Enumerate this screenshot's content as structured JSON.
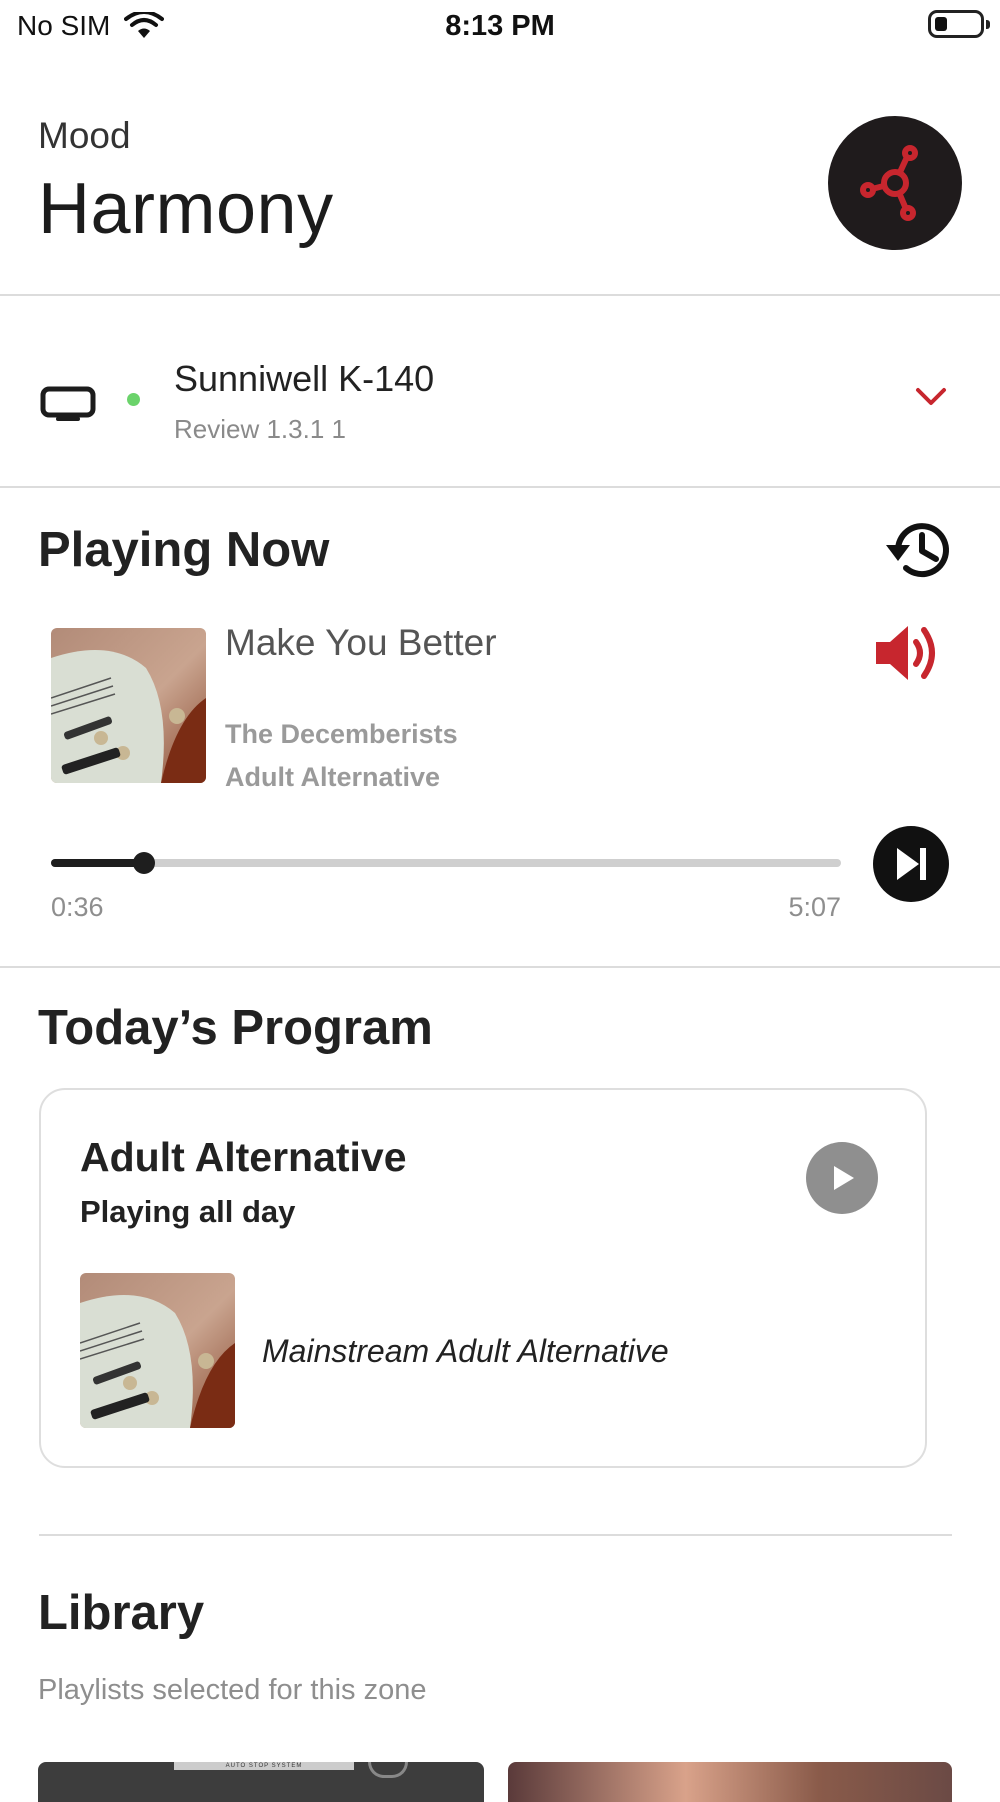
{
  "status_bar": {
    "carrier": "No SIM",
    "time": "8:13 PM"
  },
  "header": {
    "label": "Mood",
    "title": "Harmony",
    "mood_button_icon": "share-nodes-icon"
  },
  "device": {
    "name": "Sunniwell K-140",
    "subtitle": "Review 1.3.1 1",
    "status_color": "#6bd36b"
  },
  "playing_now": {
    "heading": "Playing Now",
    "track": {
      "title": "Make You Better",
      "artist": "The Decemberists",
      "genre": "Adult Alternative"
    },
    "elapsed": "0:36",
    "duration": "5:07",
    "progress_fraction": 0.118
  },
  "program": {
    "heading": "Today’s Program",
    "card_title": "Adult Alternative",
    "card_subtitle": "Playing all day",
    "playlist": "Mainstream Adult Alternative"
  },
  "library": {
    "heading": "Library",
    "subtitle": "Playlists selected for this zone",
    "thumb_caption": "AUTO STOP SYSTEM"
  },
  "colors": {
    "accent": "#c7262e",
    "dark": "#1f1b1c",
    "divider": "#dcdcdc"
  }
}
